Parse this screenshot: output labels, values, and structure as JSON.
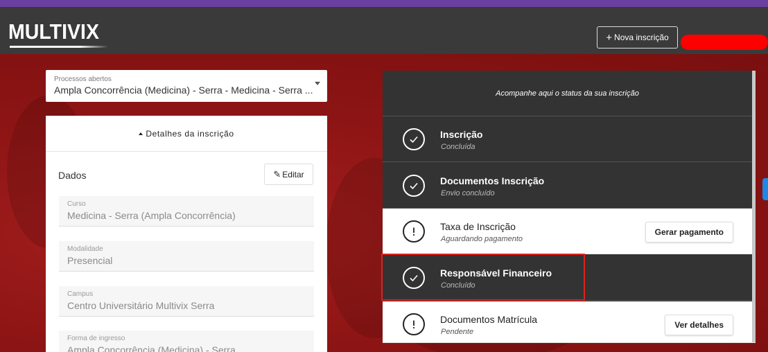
{
  "header": {
    "logo_text": "MULTIVIX",
    "nova_inscricao_label": "Nova inscrição",
    "colors": {
      "navbar": "#3a3a3a",
      "top_strip": "#6a3fa0",
      "background": "#8e1414"
    }
  },
  "processos": {
    "label": "Processos abertos",
    "selected": "Ampla Concorrência (Medicina) - Serra - Medicina - Serra ..."
  },
  "details": {
    "header": "Detalhes da inscrição",
    "dados_label": "Dados",
    "editar_label": "Editar",
    "fields": [
      {
        "label": "Curso",
        "value": "Medicina - Serra (Ampla Concorrência)"
      },
      {
        "label": "Modalidade",
        "value": "Presencial"
      },
      {
        "label": "Campus",
        "value": "Centro Universitário Multivix Serra"
      },
      {
        "label": "Forma de ingresso",
        "value": "Ampla Concorrência (Medicina) - Serra"
      }
    ]
  },
  "status": {
    "header": "Acompanhe aqui o status da sua inscrição",
    "steps": [
      {
        "title": "Inscrição",
        "subtitle": "Concluída",
        "state": "done",
        "icon": "check-circle-icon"
      },
      {
        "title": "Documentos Inscrição",
        "subtitle": "Envio concluído",
        "state": "done",
        "icon": "check-circle-icon"
      },
      {
        "title": "Taxa de Inscrição",
        "subtitle": "Aguardando pagamento",
        "state": "pending",
        "icon": "exclamation-circle-icon",
        "action": "Gerar pagamento"
      },
      {
        "title": "Responsável Financeiro",
        "subtitle": "Concluído",
        "state": "done",
        "icon": "check-circle-icon"
      },
      {
        "title": "Documentos Matrícula",
        "subtitle": "Pendente",
        "state": "pending",
        "icon": "exclamation-circle-icon",
        "action": "Ver detalhes"
      }
    ]
  }
}
